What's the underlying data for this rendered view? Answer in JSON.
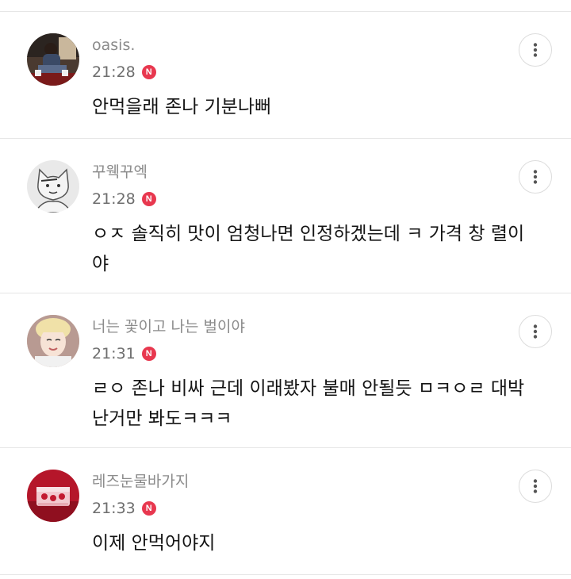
{
  "comments": [
    {
      "nickname": "oasis.",
      "time": "21:28",
      "badge": "N",
      "text": "안먹을래 존나 기분나뻐",
      "avatar_icon": "photo-avatar-seated-person"
    },
    {
      "nickname": "꾸웩꾸엑",
      "time": "21:28",
      "badge": "N",
      "text": "ㅇㅈ 솔직히 맛이 엄청나면 인정하겠는데 ㅋ 가격 창 렬이야",
      "avatar_icon": "cartoon-cat-avatar"
    },
    {
      "nickname": "너는 꽃이고 나는 벌이야",
      "time": "21:31",
      "badge": "N",
      "text": "ㄹㅇ 존나 비싸 근데 이래봤자 불매 안될듯 ㅁㅋㅇㄹ 대박난거만 봐도ㅋㅋㅋ",
      "avatar_icon": "photo-avatar-portrait"
    },
    {
      "nickname": "레즈눈물바가지",
      "time": "21:33",
      "badge": "N",
      "text": "이제 안먹어야지",
      "avatar_icon": "photo-avatar-red-cake"
    }
  ],
  "colors": {
    "badge": "#e8384f",
    "nickname": "#8b8b8b",
    "divider": "#e6e6e6"
  },
  "more_icon": "more-vertical-icon"
}
